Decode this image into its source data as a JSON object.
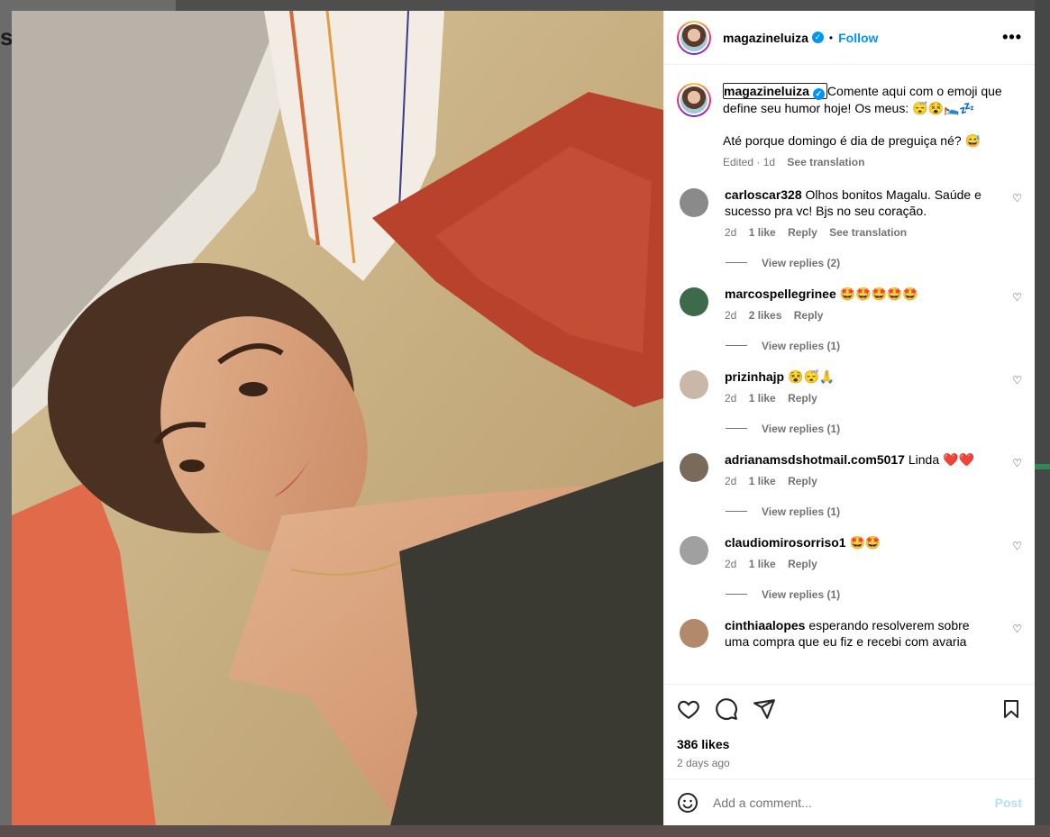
{
  "background": {
    "left_fragment": "st"
  },
  "post": {
    "username": "magazineluiza",
    "follow_label": "Follow",
    "separator": "•",
    "more_label": "•••",
    "caption_line1": "Comente aqui com o emoji que define seu humor hoje! Os meus: 😴😵🛌💤",
    "caption_line2": "Até porque domingo é dia de preguiça né? 😅",
    "caption_edited": "Edited · 1d",
    "see_translation": "See translation",
    "likes": "386 likes",
    "time_ago": "2 days ago"
  },
  "comments": [
    {
      "user": "carloscar328",
      "text": "Olhos bonitos Magalu. Saúde e sucesso pra vc! Bjs no seu coração.",
      "age": "2d",
      "likes": "1 like",
      "reply": "Reply",
      "translate": "See translation",
      "view_replies": "View replies (2)",
      "avatar_color": "#8a8a8a"
    },
    {
      "user": "marcospellegrinee",
      "text": "🤩🤩🤩🤩🤩",
      "age": "2d",
      "likes": "2 likes",
      "reply": "Reply",
      "view_replies": "View replies (1)",
      "avatar_color": "#3d6b4a"
    },
    {
      "user": "prizinhajp",
      "text": "😵😴🙏",
      "age": "2d",
      "likes": "1 like",
      "reply": "Reply",
      "view_replies": "View replies (1)",
      "avatar_color": "#c9b8a8"
    },
    {
      "user": "adrianamsdshotmail.com5017",
      "text": "Linda ❤️❤️",
      "age": "2d",
      "likes": "1 like",
      "reply": "Reply",
      "view_replies": "View replies (1)",
      "avatar_color": "#7a6a5a"
    },
    {
      "user": "claudiomirosorriso1",
      "text": "🤩🤩",
      "age": "2d",
      "likes": "1 like",
      "reply": "Reply",
      "view_replies": "View replies (1)",
      "avatar_color": "#a0a0a0"
    },
    {
      "user": "cinthiaalopes",
      "text": "esperando resolverem sobre uma compra que eu fiz e recebi com avaria",
      "avatar_color": "#b08a6a"
    }
  ],
  "composer": {
    "placeholder": "Add a comment...",
    "post_label": "Post"
  },
  "icons": {
    "verified": "verified-badge-icon",
    "like": "heart-icon",
    "comment": "comment-bubble-icon",
    "share": "paper-plane-icon",
    "save": "bookmark-icon",
    "emoji": "smiley-icon"
  },
  "colors": {
    "accent": "#0095f6",
    "muted": "#737373",
    "post_disabled": "#b2dffc"
  }
}
